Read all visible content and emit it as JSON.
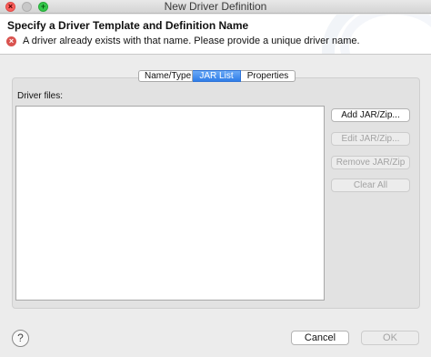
{
  "window": {
    "title": "New Driver Definition"
  },
  "header": {
    "title": "Specify a Driver Template and Definition Name",
    "message": "A driver already exists with that name. Please provide a unique driver name.",
    "message_icon": "error-icon"
  },
  "tabs": [
    {
      "label": "Name/Type",
      "active": false
    },
    {
      "label": "JAR List",
      "active": true
    },
    {
      "label": "Properties",
      "active": false
    }
  ],
  "jar_list": {
    "files_label": "Driver files:",
    "files": [],
    "buttons": {
      "add": {
        "label": "Add JAR/Zip...",
        "enabled": true
      },
      "edit": {
        "label": "Edit JAR/Zip...",
        "enabled": false
      },
      "remove": {
        "label": "Remove JAR/Zip",
        "enabled": false
      },
      "clear": {
        "label": "Clear All",
        "enabled": false
      }
    }
  },
  "footer": {
    "help_label": "?",
    "cancel_label": "Cancel",
    "ok_label": "OK",
    "ok_enabled": false
  }
}
